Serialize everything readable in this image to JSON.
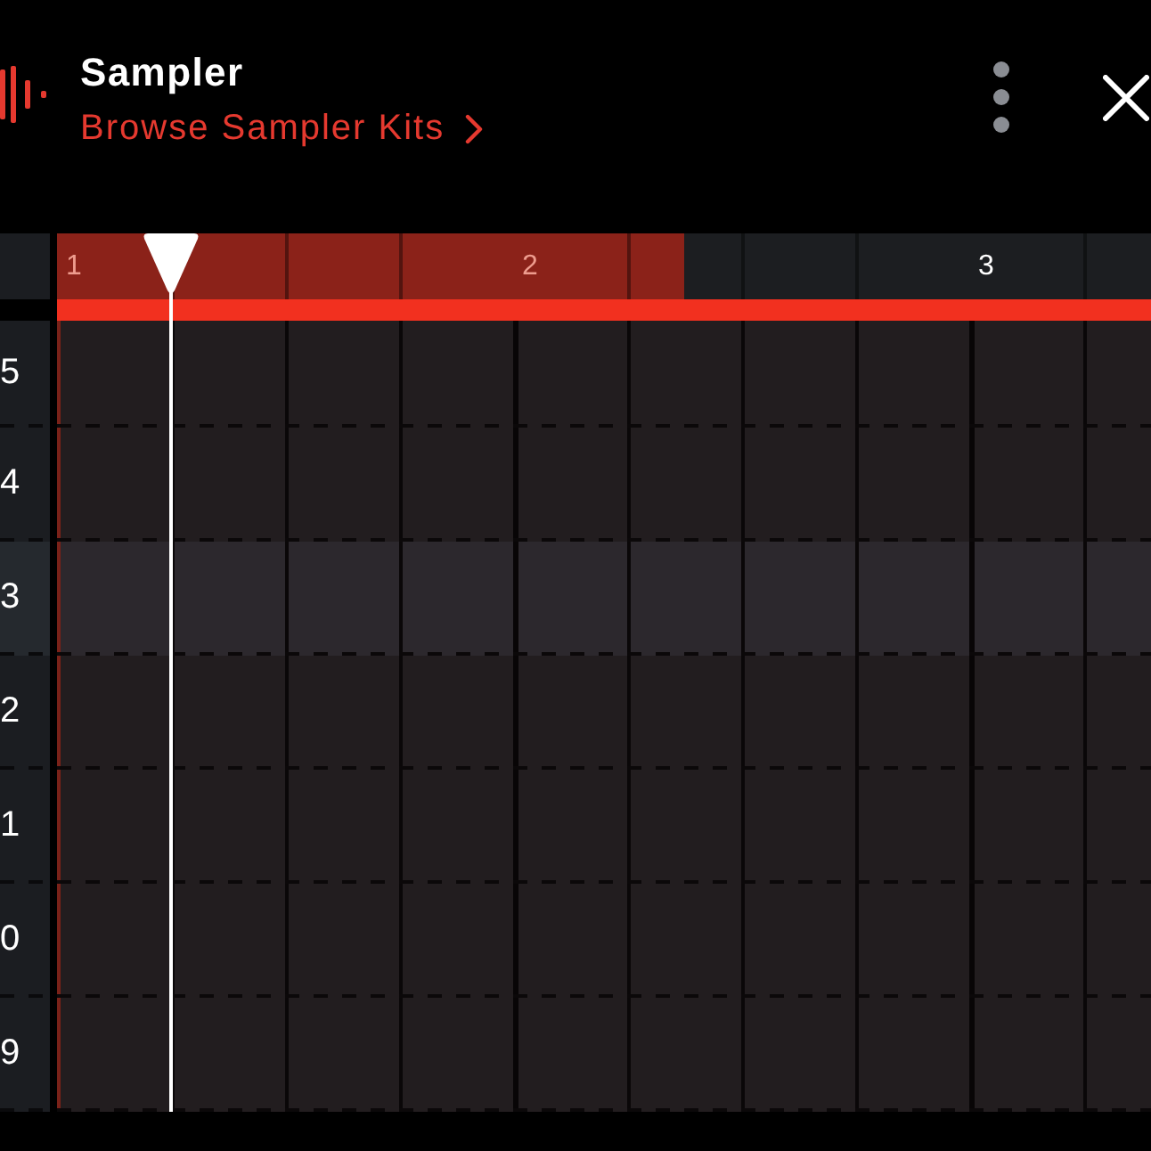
{
  "header": {
    "title": "Sampler",
    "browse_link": "Browse Sampler Kits"
  },
  "timeline": {
    "bars": [
      {
        "label": "1",
        "in_loop": true
      },
      {
        "label": "2",
        "in_loop": true
      },
      {
        "label": "3",
        "in_loop": false
      }
    ],
    "loop_region": {
      "level": 0.573
    },
    "playhead": {
      "level": 0.104
    }
  },
  "rows": [
    {
      "label": "5",
      "selected": false
    },
    {
      "label": "4",
      "selected": false
    },
    {
      "label": "3",
      "selected": true
    },
    {
      "label": "2",
      "selected": false
    },
    {
      "label": "1",
      "selected": false
    },
    {
      "label": "0",
      "selected": false
    },
    {
      "label": "9",
      "selected": false
    }
  ]
}
